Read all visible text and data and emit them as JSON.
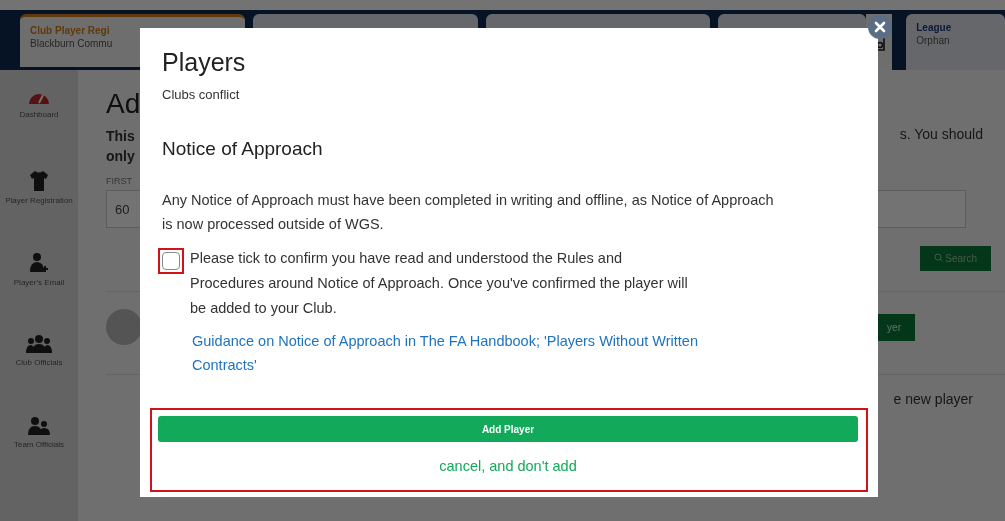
{
  "header": {
    "tabs": [
      {
        "title": "Club Player Regi",
        "subtitle": "Blackburn Commu",
        "selected": true
      },
      {
        "title": "League",
        "subtitle": "Orphan",
        "selected": false
      }
    ]
  },
  "sidebar": {
    "items": [
      {
        "label": "Dashboard"
      },
      {
        "label": "Player Registration"
      },
      {
        "label": "Player's Email"
      },
      {
        "label": "Club Officials"
      },
      {
        "label": "Team Officials"
      }
    ]
  },
  "page": {
    "heading": "Ad",
    "intro_left": [
      "This",
      "only"
    ],
    "intro_right": "s. You should",
    "field_label": "FIRST",
    "field_value": "60",
    "search_button": "Search",
    "add_button": "yer",
    "new_player_text": "e new player"
  },
  "modal": {
    "title": "Players",
    "subtitle": "Clubs conflict",
    "section_title": "Notice of Approach",
    "notice": "Any Notice of Approach must have been completed in writing and offline, as Notice of Approach is now processed outside of WGS.",
    "confirm": {
      "label": "Please tick to confirm you have read and understood the Rules and Procedures around Notice of Approach. Once you've confirmed the player will be added to your Club.",
      "checked": false
    },
    "guidance_link": "Guidance on Notice of Approach in The FA Handbook; 'Players Without Written Contracts'",
    "primary_button": "Add Player",
    "cancel_link": "cancel, and don't add"
  }
}
